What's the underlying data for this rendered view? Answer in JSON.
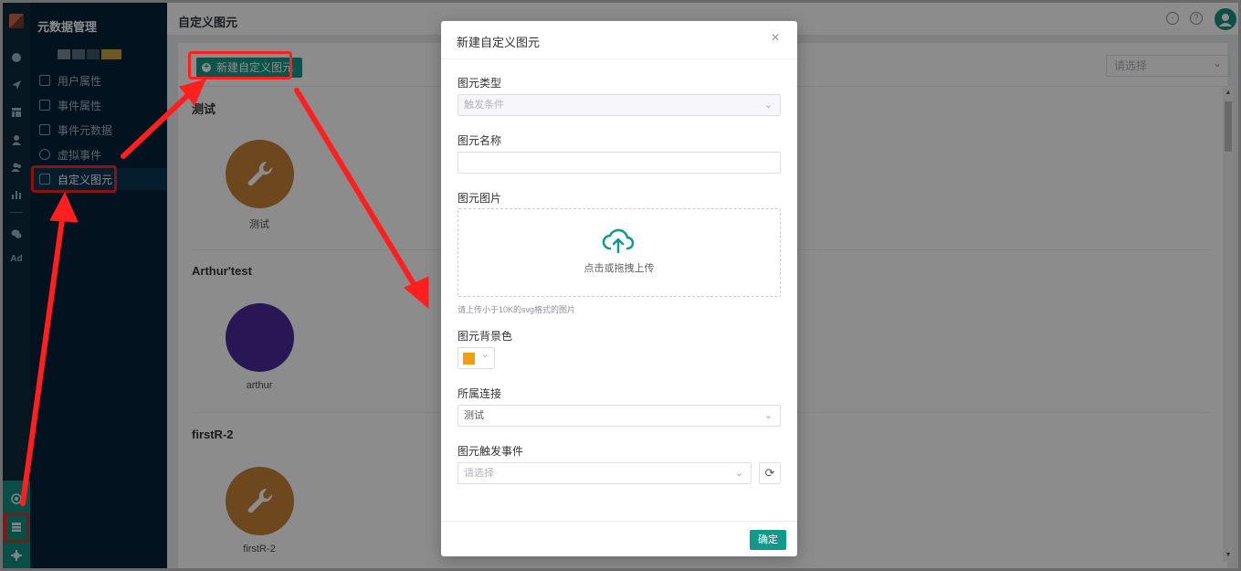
{
  "app": {
    "section_title": "元数据管理",
    "page_title": "自定义图元"
  },
  "rail": {
    "ad_label": "Ad",
    "icons": [
      "dashboard-icon",
      "send-icon",
      "layout-icon",
      "user-icon",
      "users-icon",
      "bar-chart-icon",
      "wechat-icon"
    ],
    "bottom_icons": [
      "target-icon",
      "database-icon",
      "gear-icon"
    ]
  },
  "sidebar": {
    "items": [
      {
        "label": "用户属性",
        "icon": "user-property-icon"
      },
      {
        "label": "事件属性",
        "icon": "event-property-icon"
      },
      {
        "label": "事件元数据",
        "icon": "event-metadata-icon"
      },
      {
        "label": "虚拟事件",
        "icon": "virtual-event-icon"
      },
      {
        "label": "自定义图元",
        "icon": "custom-element-icon"
      }
    ]
  },
  "toolbar": {
    "new_button": "新建自定义图元",
    "filter_placeholder": "请选择"
  },
  "groups": [
    {
      "title": "测试",
      "element": {
        "name": "测试",
        "color": "#c78236",
        "icon": "wrench-icon"
      }
    },
    {
      "title": "Arthur'test",
      "element": {
        "name": "arthur",
        "color": "#4a2a9a",
        "icon": ""
      }
    },
    {
      "title": "firstR-2",
      "element": {
        "name": "firstR-2",
        "color": "#c78236",
        "icon": "wrench-icon"
      }
    }
  ],
  "modal": {
    "title": "新建自定义图元",
    "fields": {
      "type_label": "图元类型",
      "type_value": "触发条件",
      "name_label": "图元名称",
      "name_value": "",
      "image_label": "图元图片",
      "upload_text": "点击或拖拽上传",
      "upload_hint": "请上传小于10K的svg格式的图片",
      "bg_label": "图元背景色",
      "bg_color": "#f59d0f",
      "connection_label": "所属连接",
      "connection_value": "测试",
      "event_label": "图元触发事件",
      "event_placeholder": "请选择"
    },
    "ok_button": "确定"
  },
  "colors": {
    "accent": "#13998a",
    "annotation": "#ff1f1f",
    "sidebar_bg": "#062239"
  }
}
